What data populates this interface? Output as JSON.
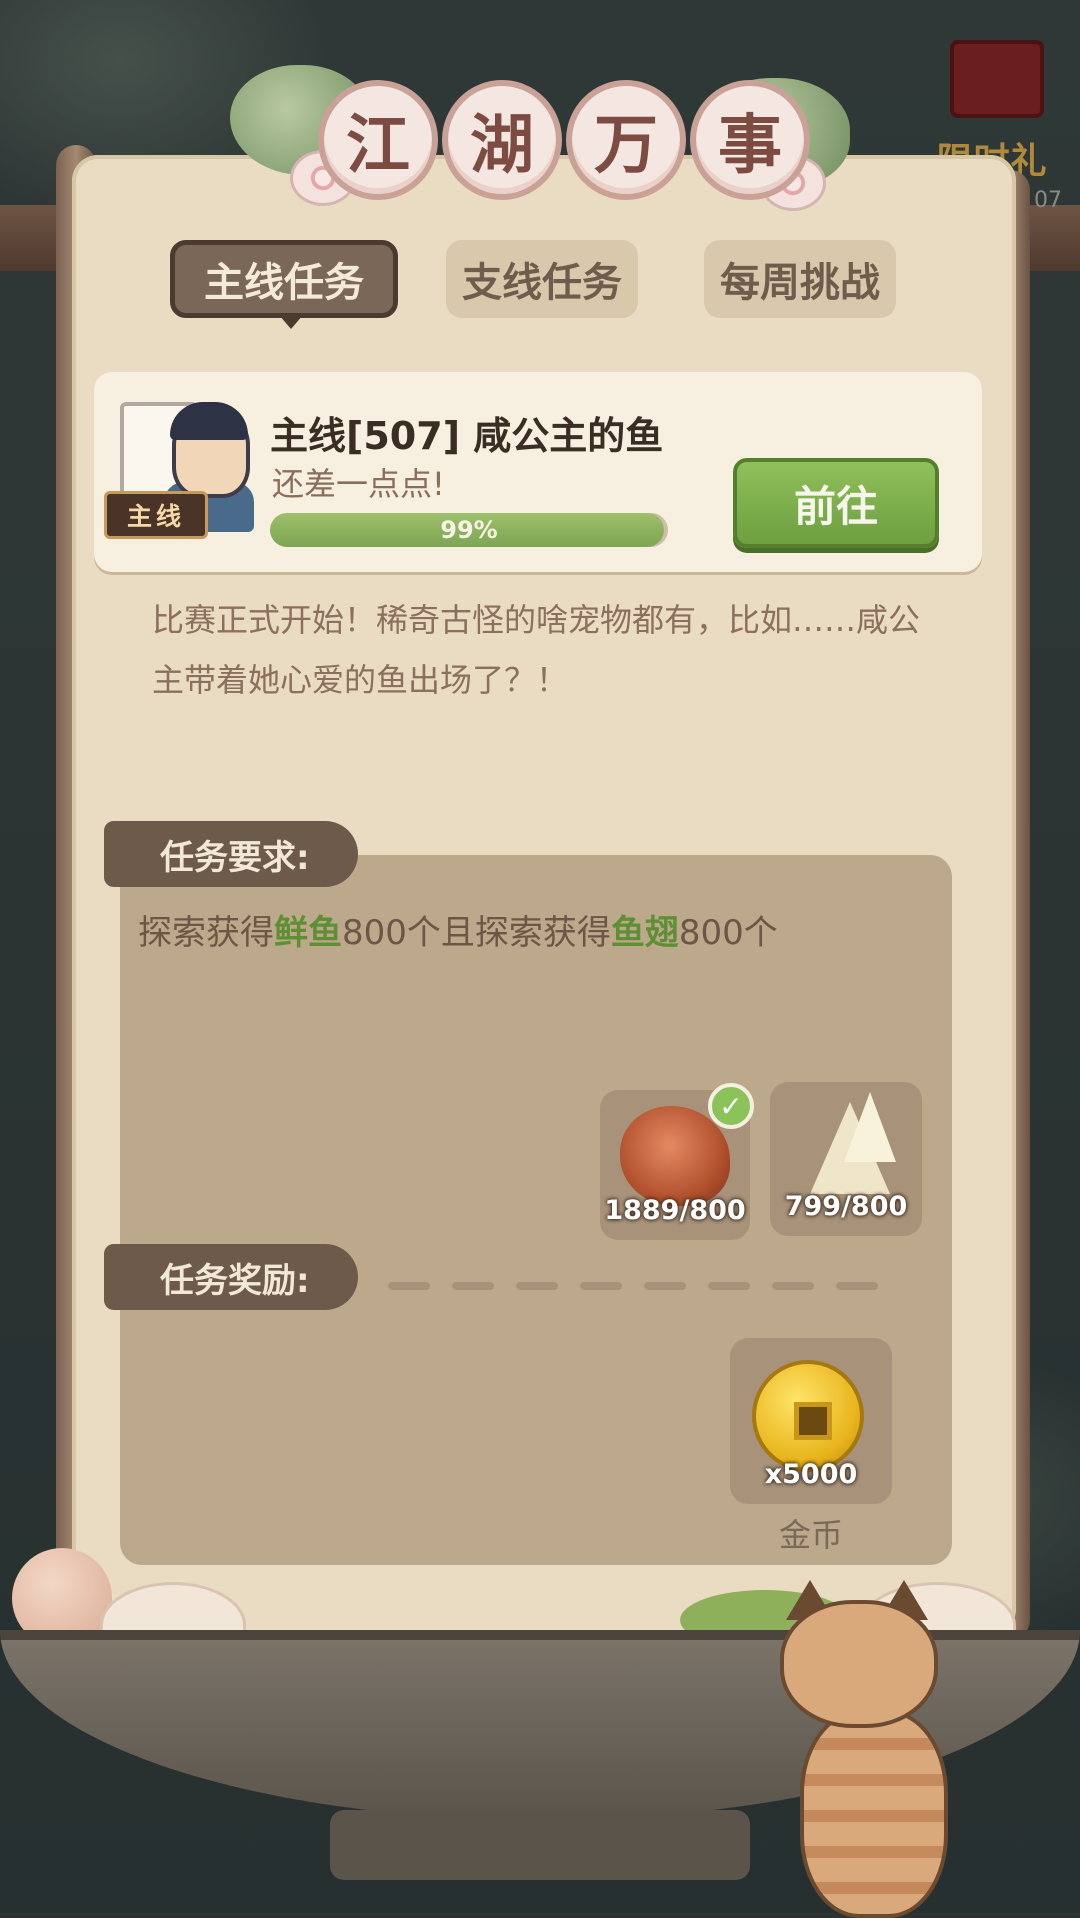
{
  "title": {
    "chars": [
      "江",
      "湖",
      "万",
      "事"
    ]
  },
  "gift": {
    "label": "限时礼包",
    "sub": "07"
  },
  "tabs": [
    {
      "label": "主线任务",
      "active": true
    },
    {
      "label": "支线任务",
      "active": false
    },
    {
      "label": "每周挑战",
      "active": false
    }
  ],
  "task": {
    "tag": "主线",
    "title": "主线[507] 咸公主的鱼",
    "subtitle": "还差一点点!",
    "progress": 0.99,
    "progress_text": "99%",
    "go_label": "前往",
    "description": "比赛正式开始！稀奇古怪的啥宠物都有，比如……咸公主带着她心爱的鱼出场了？！"
  },
  "requirements": {
    "header": "任务要求:",
    "text_parts": [
      "探索获得",
      "鲜鱼",
      "800个且探索获得",
      "鱼翅",
      "800个"
    ],
    "highlight_color": "#5f8f35",
    "items": [
      {
        "icon": "fresh-fish-meat-icon",
        "count": "1889/800",
        "completed": true
      },
      {
        "icon": "shark-fin-icon",
        "count": "799/800",
        "completed": false
      }
    ]
  },
  "rewards": {
    "header": "任务奖励:",
    "items": [
      {
        "icon": "gold-coin-icon",
        "count": "x5000",
        "label": "金币"
      }
    ]
  },
  "colors": {
    "accent_green": "#7ea554",
    "panel_brown": "#6e5a4b",
    "parchment": "#e9dcc3"
  }
}
